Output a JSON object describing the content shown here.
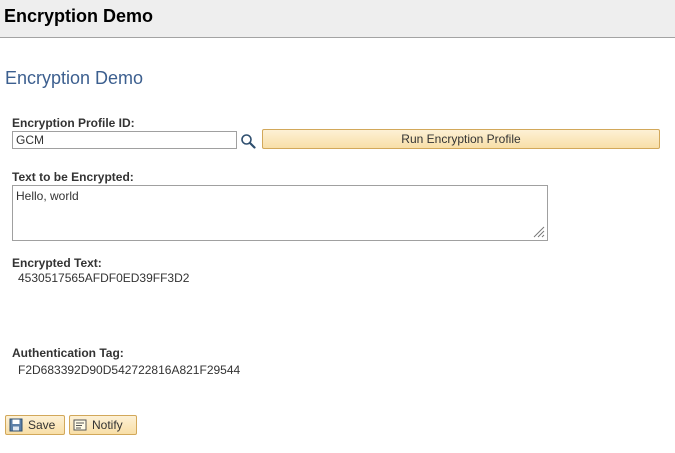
{
  "window": {
    "title": "Encryption Demo"
  },
  "page": {
    "heading": "Encryption Demo"
  },
  "form": {
    "profile_label": "Encryption Profile ID:",
    "profile_value": "GCM",
    "run_button_label": "Run Encryption Profile",
    "text_label": "Text to be Encrypted:",
    "text_value": "Hello, world",
    "encrypted_label": "Encrypted Text:",
    "encrypted_value": "4530517565AFDF0ED39FF3D2",
    "auth_tag_label": "Authentication Tag:",
    "auth_tag_value": "F2D683392D90D542722816A821F29544"
  },
  "footer": {
    "save_label": "Save",
    "notify_label": "Notify"
  },
  "icons": {
    "lookup": "magnifier-icon",
    "save": "floppy-disk-icon",
    "notify": "notify-icon",
    "resize": "resize-grip-icon"
  },
  "colors": {
    "heading": "#3c5f8f",
    "button_bg": "#f8dfa7",
    "button_border": "#d2a85a",
    "titlebar_bg": "#eeeeee"
  }
}
